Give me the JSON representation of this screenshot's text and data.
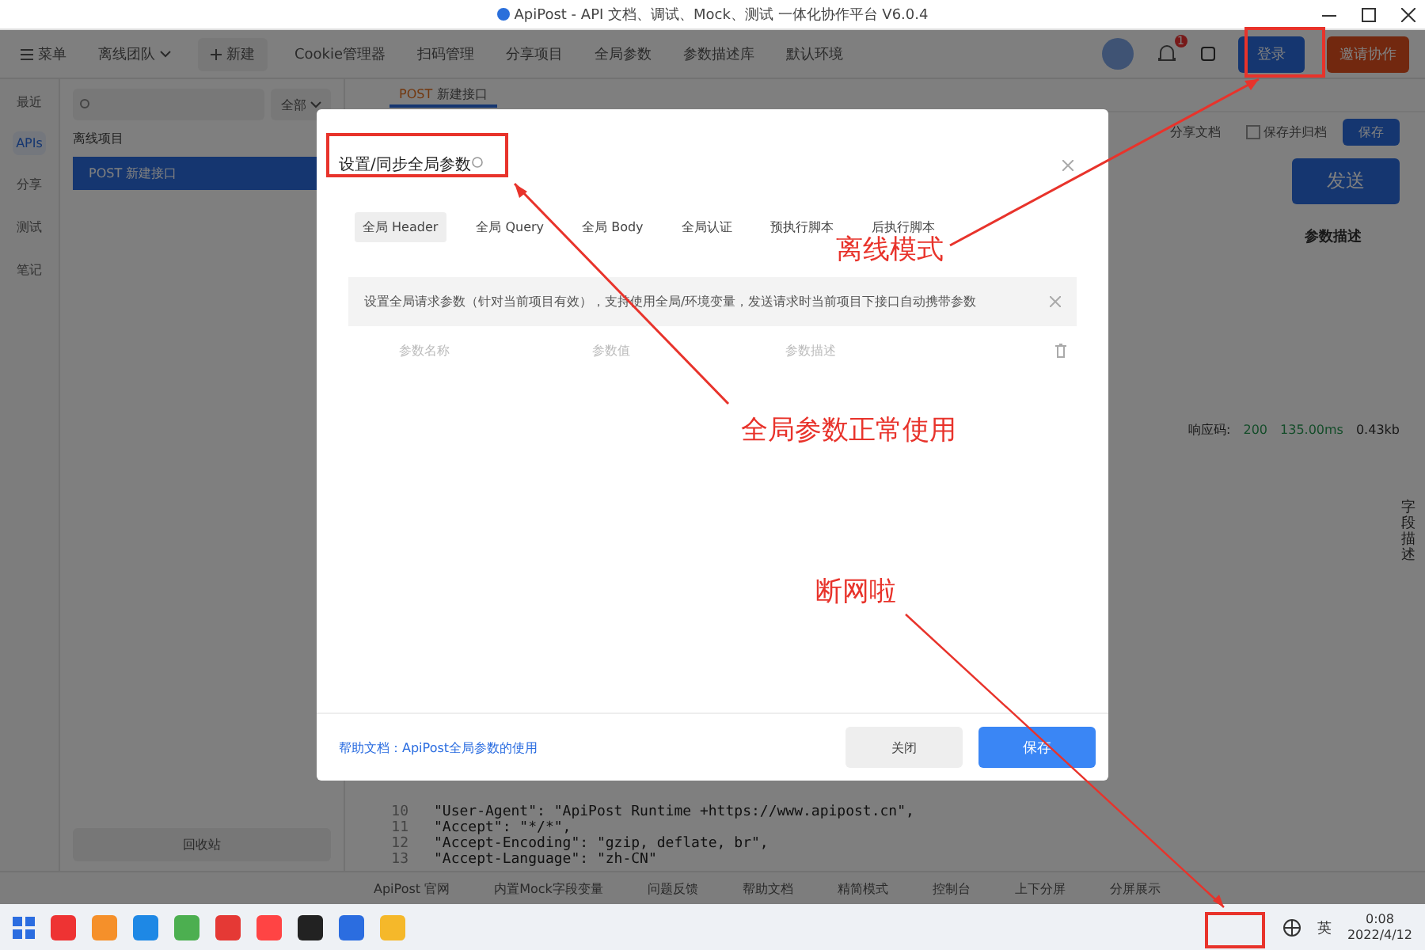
{
  "window": {
    "title": "ApiPost - API 文档、调试、Mock、测试 一体化协作平台 V6.0.4"
  },
  "toolbar": {
    "menu": "菜单",
    "team": "离线团队",
    "new": "新建",
    "items": [
      "Cookie管理器",
      "扫码管理",
      "分享项目",
      "全局参数",
      "参数描述库",
      "默认环境"
    ],
    "notification_count": "1",
    "login": "登录",
    "invite": "邀请协作"
  },
  "rail": [
    {
      "label": "最近",
      "selected": false
    },
    {
      "label": "APIs",
      "selected": true
    },
    {
      "label": "分享",
      "selected": false
    },
    {
      "label": "测试",
      "selected": false
    },
    {
      "label": "笔记",
      "selected": false
    }
  ],
  "sidebar": {
    "filter": "全部",
    "project": "离线项目",
    "items": [
      {
        "method": "POST",
        "name": "新建接口",
        "selected": true
      }
    ],
    "trash": "回收站"
  },
  "request_tabs": [
    {
      "method": "POST",
      "name": "新建接口",
      "selected": true
    }
  ],
  "request": {
    "share_doc": "分享文档",
    "save_archive": "保存并归档",
    "save_archive_checked": false,
    "save": "保存",
    "send": "发送",
    "param_desc_header": "参数描述"
  },
  "response": {
    "code_label": "响应码:",
    "code": "200",
    "time": "135.00ms",
    "size": "0.43kb",
    "side_label": "字段描述"
  },
  "code_lines": [
    {
      "number": "10",
      "text": "\"User-Agent\": \"ApiPost Runtime +https://www.apipost.cn\","
    },
    {
      "number": "11",
      "text": "\"Accept\": \"*/*\","
    },
    {
      "number": "12",
      "text": "\"Accept-Encoding\": \"gzip, deflate, br\","
    },
    {
      "number": "13",
      "text": "\"Accept-Language\": \"zh-CN\""
    }
  ],
  "bottom_bar": [
    "ApiPost 官网",
    "内置Mock字段变量",
    "问题反馈",
    "帮助文档",
    "精简模式",
    "控制台",
    "上下分屏",
    "分屏展示"
  ],
  "dialog": {
    "title": "设置/同步全局参数",
    "tabs": [
      {
        "label": "全局 Header",
        "selected": true
      },
      {
        "label": "全局 Query",
        "selected": false
      },
      {
        "label": "全局 Body",
        "selected": false
      },
      {
        "label": "全局认证",
        "selected": false
      },
      {
        "label": "预执行脚本",
        "selected": false
      },
      {
        "label": "后执行脚本",
        "selected": false
      }
    ],
    "notice": "设置全局请求参数（针对当前项目有效），支持使用全局/环境变量，发送请求时当前项目下接口自动携带参数",
    "columns": [
      {
        "placeholder": "参数名称"
      },
      {
        "placeholder": "参数值"
      },
      {
        "placeholder": "参数描述"
      }
    ],
    "help_link": "帮助文档：ApiPost全局参数的使用",
    "close": "关闭",
    "save": "保存"
  },
  "annotations": [
    {
      "text": "离线模式"
    },
    {
      "text": "全局参数正常使用"
    },
    {
      "text": "断网啦"
    }
  ],
  "taskbar": {
    "ime": "英",
    "time": "0:08",
    "date": "2022/4/12"
  }
}
